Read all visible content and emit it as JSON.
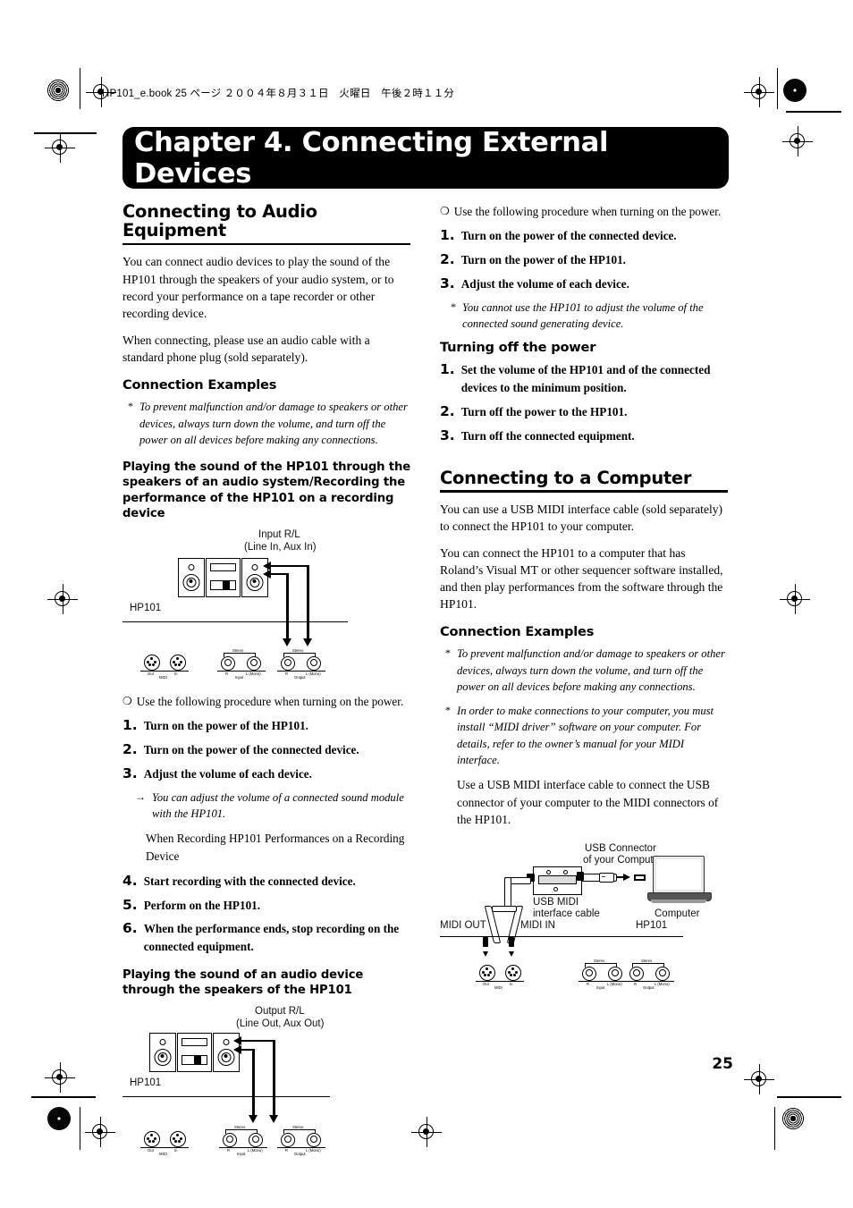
{
  "print": {
    "slug": "HP101_e.book  25 ページ  ２００４年８月３１日　火曜日　午後２時１１分",
    "page_number": "25"
  },
  "chapter": {
    "title": "Chapter 4. Connecting External Devices"
  },
  "left_column": {
    "section_title": "Connecting to Audio Equipment",
    "intro1": "You can connect audio devices to play the sound of the HP101 through the speakers of your audio system, or to record your performance on a tape recorder or other recording device.",
    "intro2": "When connecting, please use an audio cable with a standard phone plug (sold separately).",
    "connection_examples_heading": "Connection Examples",
    "caution": "To prevent malfunction and/or damage to speakers or other devices, always turn down the volume, and turn off the power on all devices before making any connections.",
    "caution_marker": "*",
    "subheading1": "Playing the sound of the HP101 through the speakers of an audio system/Recording the performance of the HP101 on a recording device",
    "bullet_ring": "❍",
    "power_on_note": "Use the following procedure when turning on the power.",
    "steps1": [
      {
        "n": "1.",
        "t": "Turn on the power of the HP101."
      },
      {
        "n": "2.",
        "t": "Turn on the power of the connected device."
      },
      {
        "n": "3.",
        "t": "Adjust the volume of each device."
      }
    ],
    "tip_marker": "→",
    "tip": "You can adjust the volume of a connected sound module with the HP101.",
    "recording_line": "When Recording HP101 Performances on a Recording Device",
    "steps2": [
      {
        "n": "4.",
        "t": "Start recording with the connected device."
      },
      {
        "n": "5.",
        "t": "Perform on the HP101."
      },
      {
        "n": "6.",
        "t": "When the performance ends, stop recording on the connected equipment."
      }
    ],
    "subheading2": "Playing the sound of an audio device through the speakers of the HP101"
  },
  "right_column": {
    "bullet_ring": "❍",
    "power_on_note": "Use the following procedure when turning on the power.",
    "steps1": [
      {
        "n": "1.",
        "t": "Turn on the power of the connected device."
      },
      {
        "n": "2.",
        "t": "Turn on the power of the HP101."
      },
      {
        "n": "3.",
        "t": "Adjust the volume of each device."
      }
    ],
    "caution_marker": "*",
    "caution": "You cannot use the HP101 to adjust the volume of the connected sound generating device.",
    "turning_off_heading": "Turning off the power",
    "steps2": [
      {
        "n": "1.",
        "t": "Set the volume of the HP101 and of the connected devices to the minimum position."
      },
      {
        "n": "2.",
        "t": "Turn off the power to the HP101."
      },
      {
        "n": "3.",
        "t": "Turn off the connected equipment."
      }
    ],
    "section_title": "Connecting to a Computer",
    "intro1": "You can use a USB MIDI interface cable (sold separately) to connect the HP101 to your computer.",
    "intro2": "You can connect the HP101 to a computer that has Roland’s Visual MT or other sequencer software installed, and then play performances from the software through the HP101.",
    "connection_examples_heading": "Connection Examples",
    "caution1_marker": "*",
    "caution1": "To prevent malfunction and/or damage to speakers or other devices, always turn down the volume, and turn off the power on all devices before making any connections.",
    "caution2_marker": "*",
    "caution2": "In order to make connections to your computer, you must install “MIDI driver” software on your computer. For details, refer to the owner’s manual for your MIDI interface.",
    "usage": "Use a USB MIDI interface cable to connect the USB connector of your computer to the MIDI connectors of the HP101."
  },
  "figure_input": {
    "title_line1": "Input R/L",
    "title_line2": "(Line In, Aux In)",
    "device_label": "HP101",
    "midi_out": "Out",
    "midi_in": "In",
    "midi_group": "MIDI",
    "stereo": "Stereo",
    "jack_r": "R",
    "jack_l": "L (Mono)",
    "input_group": "Input",
    "output_group": "Output"
  },
  "figure_output": {
    "title_line1": "Output  R/L",
    "title_line2": "(Line Out, Aux Out)",
    "device_label": "HP101",
    "midi_out": "Out",
    "midi_in": "In",
    "midi_group": "MIDI",
    "stereo": "Stereo",
    "jack_r": "R",
    "jack_l": "L (Mono)",
    "input_group": "Input",
    "output_group": "Output"
  },
  "figure_computer": {
    "usb_connector_line1": "USB Connector",
    "usb_connector_line2": "of your Computer",
    "usb_cable_line1": "USB MIDI",
    "usb_cable_line2": "interface cable",
    "computer_label": "Computer",
    "midi_out_label": "MIDI OUT",
    "midi_in_label": "MIDI IN",
    "device_label": "HP101",
    "midi_out": "Out",
    "midi_in": "In",
    "midi_group": "MIDI",
    "stereo": "Stereo",
    "jack_r": "R",
    "jack_l": "L (Mono)",
    "input_group": "Input",
    "output_group": "Output"
  }
}
